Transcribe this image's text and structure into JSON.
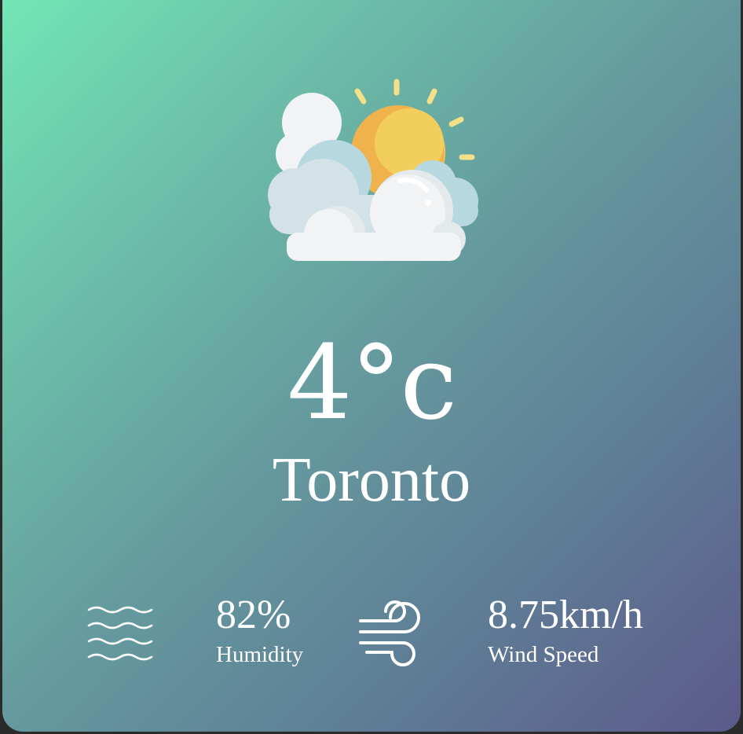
{
  "weather": {
    "icon": "partly-cloudy-sun-icon",
    "temperature": "4°c",
    "city": "Toronto"
  },
  "stats": {
    "humidity": {
      "icon": "water-waves-icon",
      "value": "82%",
      "label": "Humidity"
    },
    "wind": {
      "icon": "wind-icon",
      "value": "8.75km/h",
      "label": "Wind Speed"
    }
  },
  "colors": {
    "gradient_start": "#72e5b6",
    "gradient_end": "#5c5a8a",
    "text": "#ffffff",
    "sun": "#f0b24d",
    "sun_highlight": "#f2cf5c",
    "sun_rays": "#f5e08a",
    "cloud_light": "#f1f3f5",
    "cloud_mid": "#d3e2e7",
    "cloud_back": "#b8d8df"
  }
}
